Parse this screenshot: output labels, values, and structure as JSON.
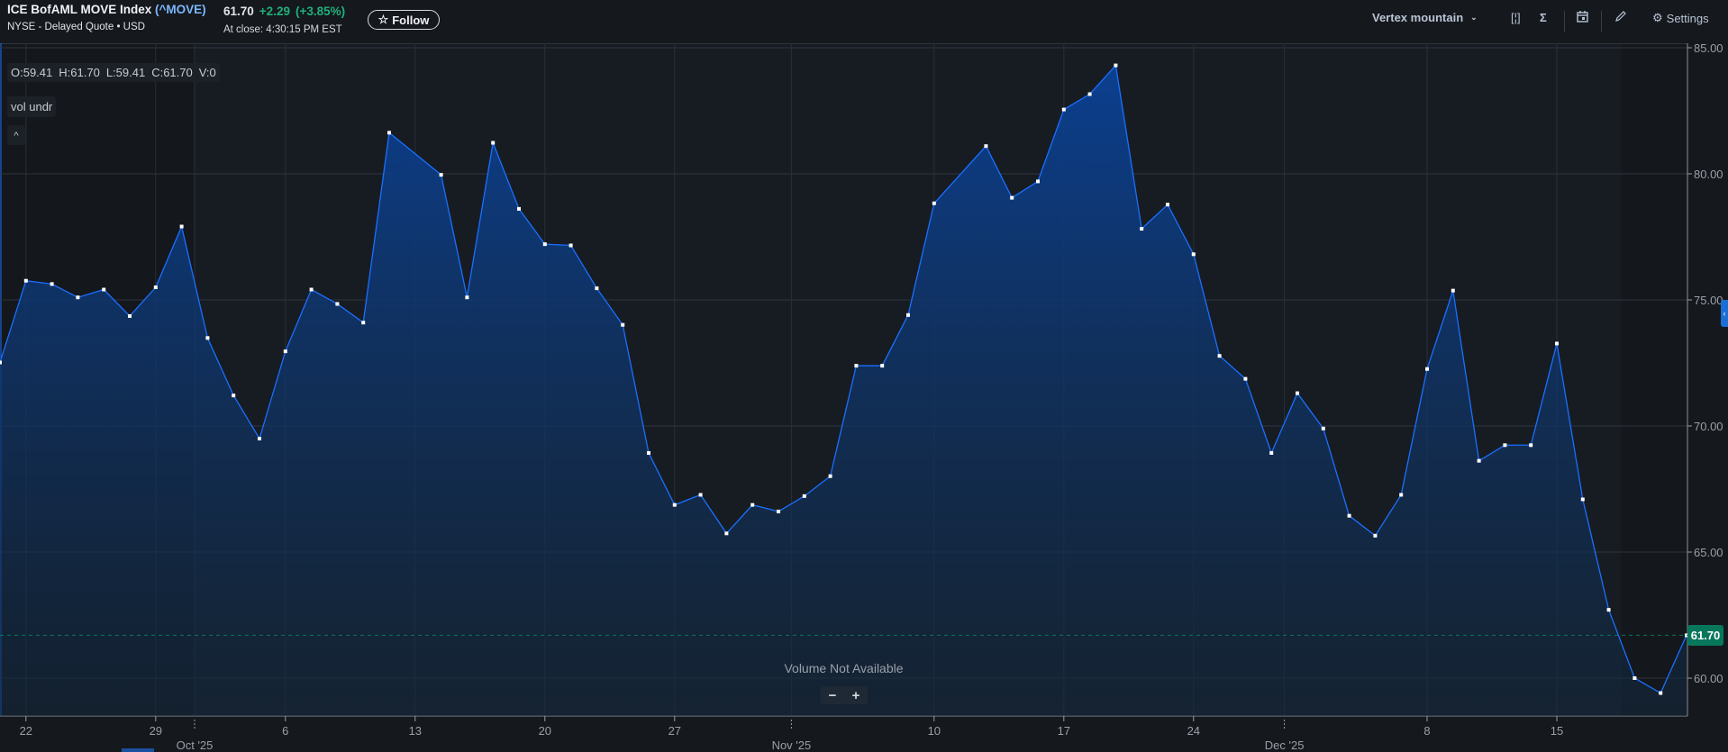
{
  "header": {
    "title": "ICE BofAML MOVE Index",
    "symbol": "(^MOVE)",
    "subtitle": "NYSE - Delayed Quote • USD",
    "price": "61.70",
    "change": "+2.29",
    "change_pct": "(+3.85%)",
    "close_time": "At close: 4:30:15 PM EST",
    "follow_label": "Follow",
    "positive_color": "#1fb07a"
  },
  "toolbar": {
    "chart_type": "Vertex mountain",
    "settings_label": "Settings",
    "icons": [
      "compare-bracket-icon",
      "indicators-sigma-icon",
      "calendar-icon",
      "draw-pencil-icon",
      "gear-icon"
    ]
  },
  "overlay": {
    "ohlc": {
      "open": "O:59.41",
      "high": "H:61.70",
      "low": "L:59.41",
      "close": "C:61.70",
      "volume": "V:0"
    },
    "study_label": "vol undr",
    "volume_message": "Volume Not Available",
    "zoom_out": "−",
    "zoom_in": "+"
  },
  "chart_data": {
    "type": "area",
    "line_color": "#1a6fff",
    "last_value_label": "61.70",
    "last_value_color": "#07775c",
    "ylim": [
      58.5,
      85.2
    ],
    "y_ticks": [
      "85.00",
      "80.00",
      "75.00",
      "70.00",
      "65.00",
      "60.00"
    ],
    "grid": true,
    "x_tick_labels": [
      {
        "date": "2025-09-22",
        "label": "22"
      },
      {
        "date": "2025-09-29",
        "label": "29"
      },
      {
        "date": "2025-10-06",
        "label": "6"
      },
      {
        "date": "2025-10-13",
        "label": "13"
      },
      {
        "date": "2025-10-20",
        "label": "20"
      },
      {
        "date": "2025-10-27",
        "label": "27"
      },
      {
        "date": "2025-11-10",
        "label": "10"
      },
      {
        "date": "2025-11-17",
        "label": "17"
      },
      {
        "date": "2025-11-24",
        "label": "24"
      },
      {
        "date": "2025-12-08",
        "label": "8"
      },
      {
        "date": "2025-12-15",
        "label": "15"
      }
    ],
    "month_labels": [
      {
        "after": "2025-09-30",
        "label": "Oct '25"
      },
      {
        "after": "2025-10-31",
        "label": "Nov '25"
      },
      {
        "after": "2025-11-28",
        "label": "Dec '25"
      }
    ],
    "axis_dates": [
      "2025-09-19",
      "2025-09-22",
      "2025-09-23",
      "2025-09-24",
      "2025-09-25",
      "2025-09-26",
      "2025-09-29",
      "2025-09-30",
      "2025-10-01",
      "2025-10-02",
      "2025-10-03",
      "2025-10-06",
      "2025-10-07",
      "2025-10-08",
      "2025-10-09",
      "2025-10-10",
      "2025-10-13",
      "2025-10-14",
      "2025-10-15",
      "2025-10-16",
      "2025-10-17",
      "2025-10-20",
      "2025-10-21",
      "2025-10-22",
      "2025-10-23",
      "2025-10-24",
      "2025-10-27",
      "2025-10-28",
      "2025-10-29",
      "2025-10-30",
      "2025-10-31",
      "2025-11-03",
      "2025-11-04",
      "2025-11-05",
      "2025-11-06",
      "2025-11-07",
      "2025-11-10",
      "2025-11-11",
      "2025-11-12",
      "2025-11-13",
      "2025-11-14",
      "2025-11-17",
      "2025-11-18",
      "2025-11-19",
      "2025-11-20",
      "2025-11-21",
      "2025-11-24",
      "2025-11-25",
      "2025-11-26",
      "2025-11-28",
      "2025-12-01",
      "2025-12-02",
      "2025-12-03",
      "2025-12-04",
      "2025-12-05",
      "2025-12-08",
      "2025-12-09",
      "2025-12-10",
      "2025-12-11",
      "2025-12-12",
      "2025-12-15",
      "2025-12-16",
      "2025-12-17",
      "2025-12-18",
      "2025-12-19",
      "2025-12-22"
    ],
    "series": [
      {
        "points": [
          [
            "2025-09-19",
            72.52
          ],
          [
            "2025-09-22",
            75.76
          ],
          [
            "2025-09-23",
            75.63
          ],
          [
            "2025-09-24",
            75.1
          ],
          [
            "2025-09-25",
            75.41
          ],
          [
            "2025-09-26",
            74.36
          ],
          [
            "2025-09-29",
            75.5
          ],
          [
            "2025-09-30",
            77.91
          ],
          [
            "2025-10-01",
            73.49
          ],
          [
            "2025-10-02",
            71.21
          ],
          [
            "2025-10-03",
            69.5
          ],
          [
            "2025-10-06",
            72.96
          ],
          [
            "2025-10-07",
            75.41
          ],
          [
            "2025-10-08",
            74.84
          ],
          [
            "2025-10-09",
            74.1
          ],
          [
            "2025-10-10",
            81.63
          ],
          [
            "2025-10-14",
            79.96
          ],
          [
            "2025-10-15",
            75.1
          ],
          [
            "2025-10-16",
            81.23
          ],
          [
            "2025-10-17",
            78.61
          ],
          [
            "2025-10-20",
            77.21
          ],
          [
            "2025-10-21",
            77.16
          ],
          [
            "2025-10-22",
            75.46
          ],
          [
            "2025-10-23",
            74.01
          ],
          [
            "2025-10-24",
            68.93
          ],
          [
            "2025-10-27",
            66.87
          ],
          [
            "2025-10-28",
            67.27
          ],
          [
            "2025-10-29",
            65.74
          ],
          [
            "2025-10-30",
            66.87
          ],
          [
            "2025-10-31",
            66.61
          ],
          [
            "2025-11-03",
            67.22
          ],
          [
            "2025-11-04",
            68.01
          ],
          [
            "2025-11-05",
            72.39
          ],
          [
            "2025-11-06",
            72.39
          ],
          [
            "2025-11-07",
            74.4
          ],
          [
            "2025-11-10",
            78.83
          ],
          [
            "2025-11-12",
            81.1
          ],
          [
            "2025-11-13",
            79.05
          ],
          [
            "2025-11-14",
            79.7
          ],
          [
            "2025-11-17",
            82.55
          ],
          [
            "2025-11-18",
            83.16
          ],
          [
            "2025-11-19",
            84.3
          ],
          [
            "2025-11-20",
            77.82
          ],
          [
            "2025-11-21",
            78.78
          ],
          [
            "2025-11-24",
            76.81
          ],
          [
            "2025-11-25",
            72.78
          ],
          [
            "2025-11-26",
            71.87
          ],
          [
            "2025-11-28",
            68.93
          ],
          [
            "2025-12-01",
            71.3
          ],
          [
            "2025-12-02",
            69.9
          ],
          [
            "2025-12-03",
            66.44
          ],
          [
            "2025-12-04",
            65.65
          ],
          [
            "2025-12-05",
            67.27
          ],
          [
            "2025-12-08",
            72.26
          ],
          [
            "2025-12-09",
            75.37
          ],
          [
            "2025-12-10",
            68.62
          ],
          [
            "2025-12-11",
            69.24
          ],
          [
            "2025-12-12",
            69.24
          ],
          [
            "2025-12-15",
            73.27
          ],
          [
            "2025-12-16",
            67.09
          ],
          [
            "2025-12-17",
            62.71
          ],
          [
            "2025-12-18",
            60.0
          ],
          [
            "2025-12-19",
            59.41
          ],
          [
            "2025-12-22",
            61.7
          ]
        ]
      }
    ]
  }
}
